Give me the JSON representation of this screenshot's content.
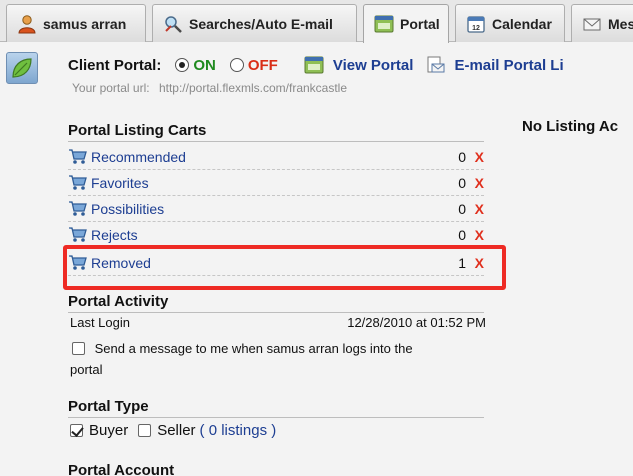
{
  "tabs": [
    {
      "label": "samus arran",
      "icon": "user-icon"
    },
    {
      "label": "Searches/Auto E-mail",
      "icon": "search-tools-icon"
    },
    {
      "label": "Portal",
      "icon": "portal-icon",
      "active": true
    },
    {
      "label": "Calendar",
      "icon": "calendar-icon"
    },
    {
      "label": "Mes",
      "icon": "envelope-icon"
    }
  ],
  "client_portal": {
    "label": "Client Portal:",
    "on_label": "ON",
    "off_label": "OFF",
    "selected": "ON",
    "view_portal": "View Portal",
    "email_portal": "E-mail Portal Li",
    "url_label": "Your portal url:",
    "url": "http://portal.flexmls.com/frankcastle"
  },
  "no_listing_activity": "No Listing Ac",
  "listing_carts": {
    "heading": "Portal Listing Carts",
    "items": [
      {
        "label": "Recommended",
        "count": "0",
        "remove": "X"
      },
      {
        "label": "Favorites",
        "count": "0",
        "remove": "X"
      },
      {
        "label": "Possibilities",
        "count": "0",
        "remove": "X"
      },
      {
        "label": "Rejects",
        "count": "0",
        "remove": "X"
      },
      {
        "label": "Removed",
        "count": "1",
        "remove": "X"
      }
    ]
  },
  "activity": {
    "heading": "Portal Activity",
    "last_login_label": "Last Login",
    "last_login_value": "12/28/2010 at 01:52 PM",
    "notify_line1": "Send a message to me when samus arran logs into the",
    "notify_line2": "portal",
    "notify_checked": false
  },
  "portal_type": {
    "heading": "Portal Type",
    "buyer_label": "Buyer",
    "buyer_checked": true,
    "seller_label": "Seller",
    "seller_checked": false,
    "listings_link": "( 0 listings )"
  },
  "portal_account": {
    "heading": "Portal Account"
  },
  "colors": {
    "on": "#1f8a1f",
    "off": "#d92e17",
    "link": "#1d3e92",
    "remove_x": "#e0301e",
    "highlight": "#ee2a24"
  }
}
